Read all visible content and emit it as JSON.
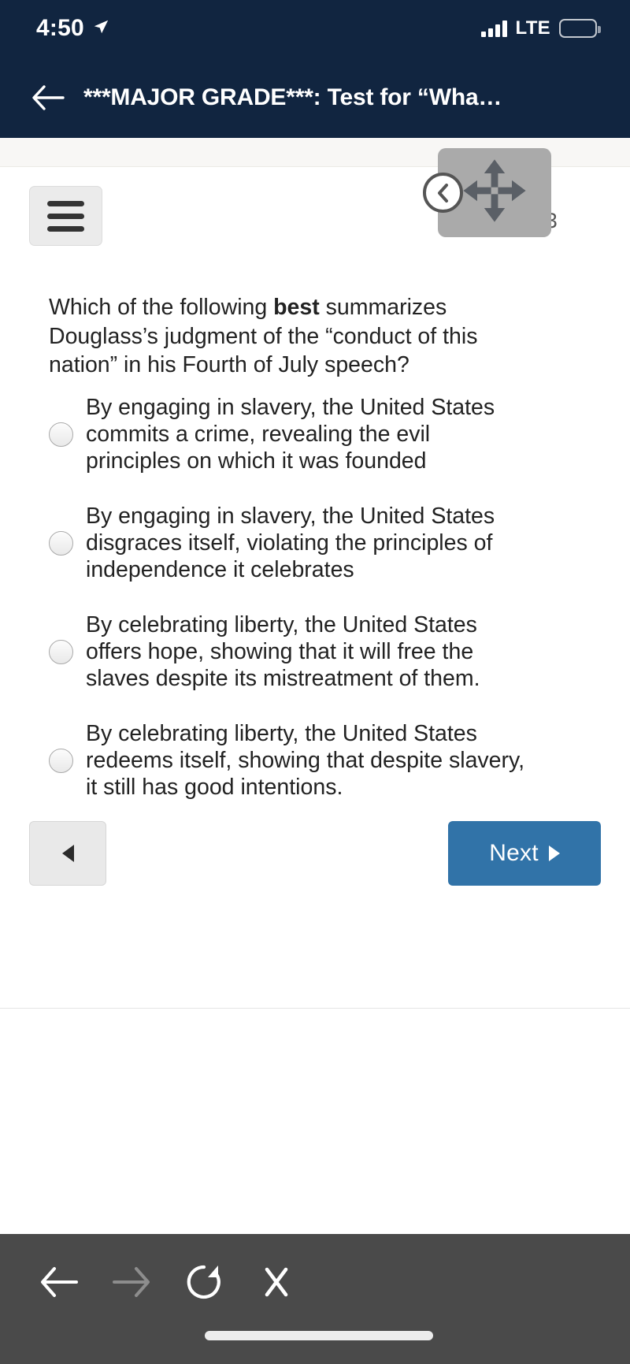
{
  "status_bar": {
    "time": "4:50",
    "location_icon": "location-arrow-icon",
    "carrier_network": "LTE",
    "signal_bars": 4,
    "battery_percent": 20,
    "battery_color": "#f0554c"
  },
  "nav_bar": {
    "back_icon": "back-arrow-icon",
    "title": "***MAJOR GRADE***: Test for “Wha…"
  },
  "quiz": {
    "menu_icon": "hamburger-menu-icon",
    "page_counter": "3 of 13",
    "question": {
      "prefix": "Which of the following ",
      "emphasis": "best",
      "suffix": " summarizes Douglass’s judgment of the “conduct of this nation” in his Fourth of July speech?"
    },
    "options": [
      {
        "text": "By engaging in slavery, the United States commits a crime, revealing the evil principles on which it was founded",
        "selected": false
      },
      {
        "text": "By engaging in slavery, the United States disgraces itself, violating the principles of independence it celebrates",
        "selected": false
      },
      {
        "text": "By celebrating liberty, the United States offers hope, showing that it will free the slaves despite its mistreatment of them.",
        "selected": false
      },
      {
        "text": "By celebrating liberty, the United States redeems itself, showing that despite slavery, it still has good intentions.",
        "selected": false
      }
    ],
    "prev_button": {
      "icon": "triangle-left-icon",
      "label": ""
    },
    "next_button": {
      "label": "Next",
      "icon": "triangle-right-icon",
      "color": "#3173a8"
    }
  },
  "float_widget": {
    "collapse_icon": "chevron-left-circle-icon",
    "move_icon": "move-four-arrows-icon",
    "background": "#aaaaaa"
  },
  "browser_toolbar": {
    "background": "#4a4a4a",
    "items": [
      {
        "icon": "back-arrow-icon",
        "enabled": true
      },
      {
        "icon": "forward-arrow-icon",
        "enabled": false
      },
      {
        "icon": "reload-icon",
        "enabled": true
      },
      {
        "icon": "close-x-icon",
        "enabled": true
      }
    ],
    "home_indicator": "home-indicator-bar"
  }
}
